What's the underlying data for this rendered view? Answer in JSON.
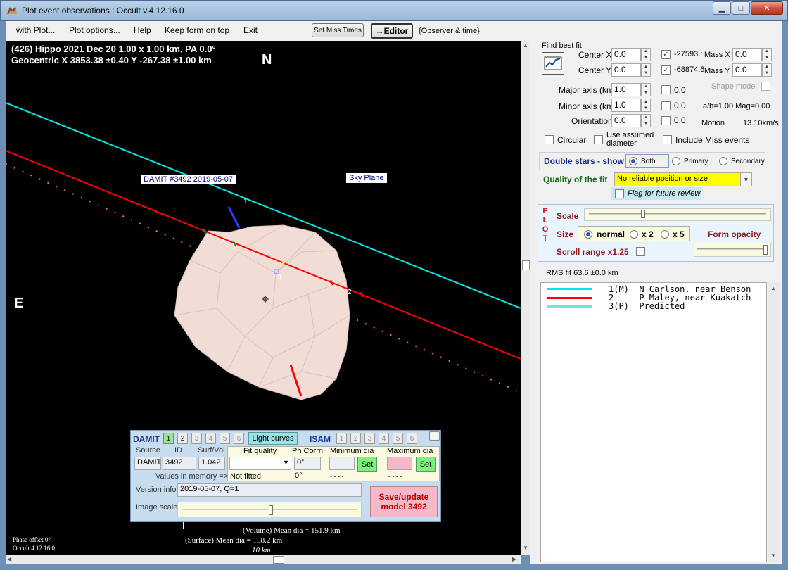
{
  "window": {
    "title": "Plot event observations : Occult v.4.12.16.0",
    "min_label": "▁",
    "max_label": "□",
    "close_label": "✕"
  },
  "menu": {
    "items": [
      "with Plot...",
      "Plot options...",
      "Help",
      "Keep form on top",
      "Exit"
    ],
    "set_miss_times": "Set Miss Times",
    "editor": "→Editor",
    "observer_time": "{Observer & time}"
  },
  "plot": {
    "header_line1": "(426) Hippo  2021 Dec 20   1.00 x 1.00 km, PA 0.0°",
    "header_line2": "Geocentric  X  3853.38 ±0.40  Y  -267.38 ±1.00 km",
    "north": "N",
    "east": "E",
    "damit_label": "DAMIT #3492 2019-05-07",
    "sky_plane_label": "Sky Plane",
    "chord_labels": [
      "1",
      "2",
      "2",
      "3"
    ],
    "volume_dia": "(Volume) Mean dia = 151.9 km",
    "surface_dia": "(Surface) Mean dia = 158.2 km",
    "scale_label": "10 km",
    "phase_offset": "Phase offset 0°",
    "version": "Occult 4.12.16.0",
    "colors": {
      "cyan_chord": "#00e8e8",
      "red_chord": "#ff0000",
      "shape": "#f2ddd6"
    }
  },
  "damit": {
    "title": "DAMIT",
    "buttons": [
      "1",
      "2",
      "3",
      "4",
      "5",
      "6"
    ],
    "light_curves": "Light curves",
    "isam_title": "ISAM",
    "isam_buttons": [
      "1",
      "2",
      "3",
      "4",
      "5",
      "6"
    ],
    "source_hdr": "Source",
    "id_hdr": "ID",
    "surfvol_hdr": "Surf/Vol",
    "source": "DAMIT",
    "id": "3492",
    "surfvol": "1.042",
    "fit_quality_hdr": "Fit quality",
    "ph_corrn_hdr": "Ph Corrn",
    "min_dia_hdr": "Minimum dia",
    "max_dia_hdr": "Maximum dia",
    "ph_corrn": "0°",
    "set": "Set",
    "values_in_memory": "Values in memory =>",
    "not_fitted": "Not fitted",
    "ph_corrn_mem": "0°",
    "min_mem": "- - - -",
    "max_mem": "- - - -",
    "version_info_lbl": "Version info",
    "version_info": "2019-05-07, Q=1",
    "image_scale_lbl": "Image scale",
    "save_update": "Save/update model 3492"
  },
  "fit": {
    "find_best_fit": "Find best fit",
    "center_x_lbl": "Center X",
    "center_y_lbl": "Center Y",
    "center_x": "0.0",
    "center_y": "0.0",
    "val_x": "-27593.:",
    "val_y": "-68874.6",
    "mass_x_lbl": "Mass X",
    "mass_y_lbl": "Mass Y",
    "mass_x": "0.0",
    "mass_y": "0.0",
    "major_lbl": "Major axis (km)",
    "minor_lbl": "Minor axis (km)",
    "orient_lbl": "Orientation",
    "major": "1.0",
    "minor": "1.0",
    "orient": "0.0",
    "major_chk_val": "0.0",
    "minor_chk_val": "0.0",
    "orient_chk_val": "0.0",
    "shape_model": "Shape model",
    "ab_mag": "a/b=1.00  Mag=0.00",
    "motion_lbl": "Motion",
    "motion": "13.10km/s",
    "circular": "Circular",
    "use_assumed": "Use assumed diameter",
    "include_miss": "Include Miss events",
    "double_stars": "Double stars - show",
    "both": "Both",
    "primary": "Primary",
    "secondary": "Secondary",
    "quality_lbl": "Quality of the fit",
    "quality": "No reliable position or size",
    "flag_review": "Flag for future review"
  },
  "plot_opts": {
    "plot_letters": [
      "P",
      "L",
      "O",
      "T"
    ],
    "scale": "Scale",
    "size": "Size",
    "normal": "normal",
    "x2": "x 2",
    "x5": "x 5",
    "form_opacity": "Form opacity",
    "scroll_range": "Scroll range x1.25"
  },
  "rms": "RMS fit 63.6 ±0.0 km",
  "legend": [
    {
      "text": "1(M)  N Carlson, near Benson",
      "color": "#00e8e8"
    },
    {
      "text": "2     P Maley, near Kuakatch",
      "color": "#ff0000"
    },
    {
      "text": "3(P)  Predicted",
      "color": "#70e8d8"
    }
  ]
}
